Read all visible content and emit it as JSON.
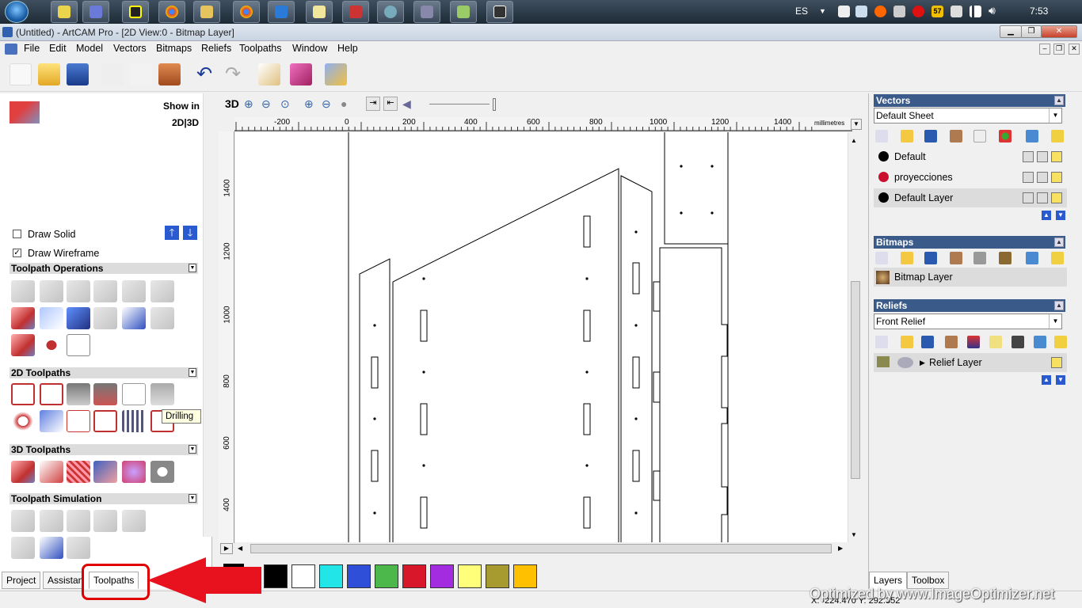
{
  "taskbar": {
    "lang": "ES",
    "clock": "7:53",
    "badge": "57"
  },
  "window": {
    "title": "(Untitled) - ArtCAM Pro - [2D View:0 - Bitmap Layer]"
  },
  "menu": [
    "File",
    "Edit",
    "Model",
    "Vectors",
    "Bitmaps",
    "Reliefs",
    "Toolpaths",
    "Window",
    "Help"
  ],
  "left": {
    "show_in": "Show in",
    "show_in_modes": "2D|3D",
    "draw_solid": "Draw Solid",
    "draw_wireframe": "Draw Wireframe",
    "sections": {
      "ops": "Toolpath Operations",
      "tp2d": "2D Toolpaths",
      "tp3d": "3D Toolpaths",
      "sim": "Toolpath Simulation"
    },
    "tooltip": "Drilling",
    "tabs": [
      "Project",
      "Assistan",
      "Toolpaths"
    ]
  },
  "view": {
    "label3d": "3D",
    "units": "millimetres",
    "h_ticks": [
      "-200",
      "0",
      "200",
      "400",
      "600",
      "800",
      "1000",
      "1200",
      "1400"
    ],
    "v_ticks": [
      "1400",
      "1200",
      "1000",
      "800",
      "600",
      "400"
    ]
  },
  "palette": [
    "#000000",
    "#ffffff",
    "#22e5e8",
    "#2f4fd8",
    "#4cb84c",
    "#d8182a",
    "#a32ce0",
    "#ffff7a",
    "#a79b2f",
    "#ffc000"
  ],
  "right": {
    "vectors": {
      "title": "Vectors",
      "sheet": "Default Sheet",
      "layers": [
        {
          "name": "Default",
          "color": "#000000"
        },
        {
          "name": "proyecciones",
          "color": "#c8102e"
        },
        {
          "name": "Default Layer",
          "color": "#000000"
        }
      ]
    },
    "bitmaps": {
      "title": "Bitmaps",
      "layer": "Bitmap Layer"
    },
    "reliefs": {
      "title": "Reliefs",
      "relief": "Front Relief",
      "layer": "Relief Layer"
    },
    "tabs": [
      "Layers",
      "Toolbox"
    ]
  },
  "status": {
    "coords": "X: -224.470   Y: 292.352"
  },
  "watermark": "Optimized by www.ImageOptimizer.net"
}
